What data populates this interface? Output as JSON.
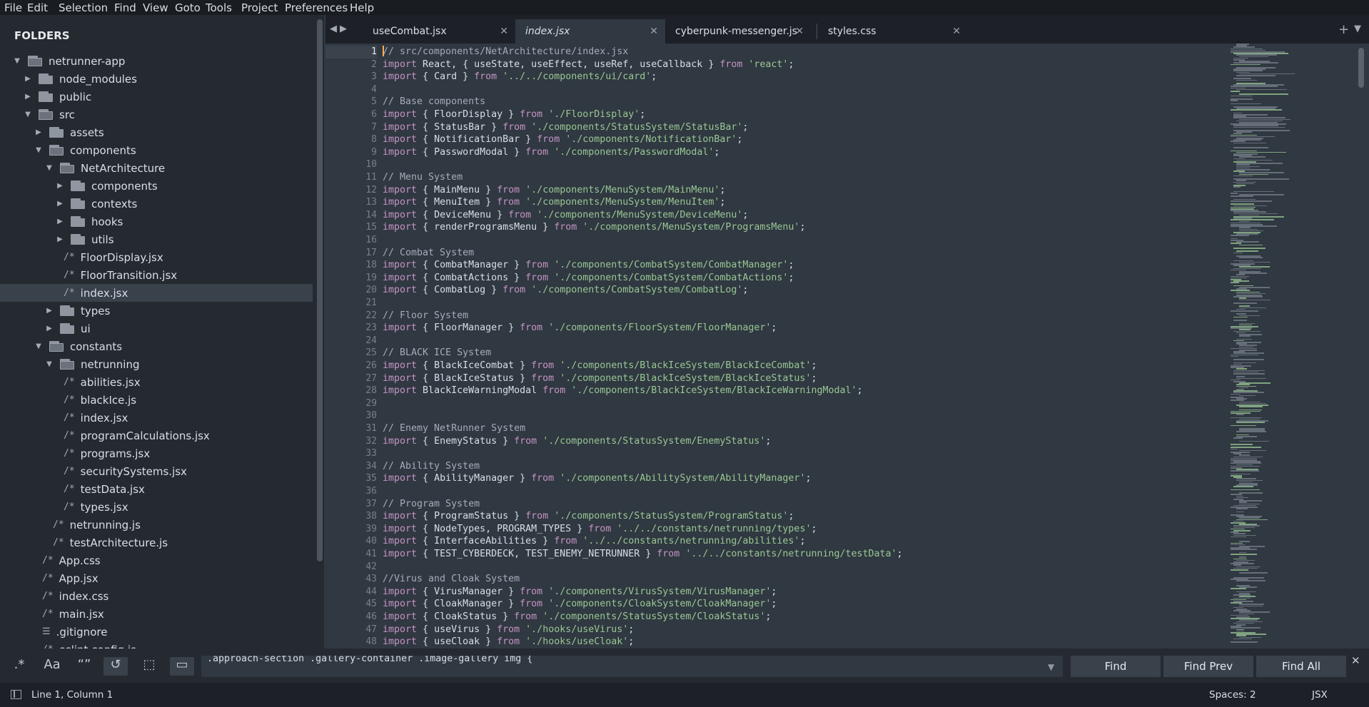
{
  "menu": [
    "File",
    "Edit",
    "Selection",
    "Find",
    "View",
    "Goto",
    "Tools",
    "Project",
    "Preferences",
    "Help"
  ],
  "sidebar": {
    "header": "FOLDERS",
    "items": [
      {
        "label": "netrunner-app",
        "type": "folder",
        "open": true,
        "depth": 0
      },
      {
        "label": "node_modules",
        "type": "folder",
        "open": false,
        "depth": 1
      },
      {
        "label": "public",
        "type": "folder",
        "open": false,
        "depth": 1
      },
      {
        "label": "src",
        "type": "folder",
        "open": true,
        "depth": 1
      },
      {
        "label": "assets",
        "type": "folder",
        "open": false,
        "depth": 2
      },
      {
        "label": "components",
        "type": "folder",
        "open": true,
        "depth": 2
      },
      {
        "label": "NetArchitecture",
        "type": "folder",
        "open": true,
        "depth": 3
      },
      {
        "label": "components",
        "type": "folder",
        "open": false,
        "depth": 4
      },
      {
        "label": "contexts",
        "type": "folder",
        "open": false,
        "depth": 4
      },
      {
        "label": "hooks",
        "type": "folder",
        "open": false,
        "depth": 4
      },
      {
        "label": "utils",
        "type": "folder",
        "open": false,
        "depth": 4
      },
      {
        "label": "FloorDisplay.jsx",
        "type": "file",
        "depth": 4
      },
      {
        "label": "FloorTransition.jsx",
        "type": "file",
        "depth": 4
      },
      {
        "label": "index.jsx",
        "type": "file",
        "depth": 4,
        "selected": true
      },
      {
        "label": "types",
        "type": "folder",
        "open": false,
        "depth": 3
      },
      {
        "label": "ui",
        "type": "folder",
        "open": false,
        "depth": 3
      },
      {
        "label": "constants",
        "type": "folder",
        "open": true,
        "depth": 2
      },
      {
        "label": "netrunning",
        "type": "folder",
        "open": true,
        "depth": 3
      },
      {
        "label": "abilities.jsx",
        "type": "file",
        "depth": 4
      },
      {
        "label": "blackIce.js",
        "type": "file",
        "depth": 4
      },
      {
        "label": "index.jsx",
        "type": "file",
        "depth": 4
      },
      {
        "label": "programCalculations.jsx",
        "type": "file",
        "depth": 4
      },
      {
        "label": "programs.jsx",
        "type": "file",
        "depth": 4
      },
      {
        "label": "securitySystems.jsx",
        "type": "file",
        "depth": 4
      },
      {
        "label": "testData.jsx",
        "type": "file",
        "depth": 4
      },
      {
        "label": "types.jsx",
        "type": "file",
        "depth": 4
      },
      {
        "label": "netrunning.js",
        "type": "file",
        "depth": 3
      },
      {
        "label": "testArchitecture.js",
        "type": "file",
        "depth": 3
      },
      {
        "label": "App.css",
        "type": "file",
        "depth": 2
      },
      {
        "label": "App.jsx",
        "type": "file",
        "depth": 2
      },
      {
        "label": "index.css",
        "type": "file",
        "depth": 2
      },
      {
        "label": "main.jsx",
        "type": "file",
        "depth": 2
      },
      {
        "label": ".gitignore",
        "type": "lines",
        "depth": 2
      },
      {
        "label": "eslint.config.js",
        "type": "file",
        "depth": 2
      }
    ]
  },
  "tabs": [
    {
      "label": "useCombat.jsx",
      "active": false
    },
    {
      "label": "index.jsx",
      "active": true
    },
    {
      "label": "cyberpunk-messenger.js",
      "active": false
    },
    {
      "label": "styles.css",
      "active": false
    }
  ],
  "editor": {
    "current_line": 1,
    "lines": [
      "// src/components/NetArchitecture/index.jsx",
      "import React, { useState, useEffect, useRef, useCallback } from 'react';",
      "import { Card } from '../../components/ui/card';",
      "",
      "// Base components",
      "import { FloorDisplay } from './FloorDisplay';",
      "import { StatusBar } from './components/StatusSystem/StatusBar';",
      "import { NotificationBar } from './components/NotificationBar';",
      "import { PasswordModal } from './components/PasswordModal';",
      "",
      "// Menu System",
      "import { MainMenu } from './components/MenuSystem/MainMenu';",
      "import { MenuItem } from './components/MenuSystem/MenuItem';",
      "import { DeviceMenu } from './components/MenuSystem/DeviceMenu';",
      "import { renderProgramsMenu } from './components/MenuSystem/ProgramsMenu';",
      "",
      "// Combat System",
      "import { CombatManager } from './components/CombatSystem/CombatManager';",
      "import { CombatActions } from './components/CombatSystem/CombatActions';",
      "import { CombatLog } from './components/CombatSystem/CombatLog';",
      "",
      "// Floor System",
      "import { FloorManager } from './components/FloorSystem/FloorManager';",
      "",
      "// BLACK ICE System",
      "import { BlackIceCombat } from './components/BlackIceSystem/BlackIceCombat';",
      "import { BlackIceStatus } from './components/BlackIceSystem/BlackIceStatus';",
      "import BlackIceWarningModal from './components/BlackIceSystem/BlackIceWarningModal';",
      "",
      "",
      "// Enemy NetRunner System",
      "import { EnemyStatus } from './components/StatusSystem/EnemyStatus';",
      "",
      "// Ability System",
      "import { AbilityManager } from './components/AbilitySystem/AbilityManager';",
      "",
      "// Program System",
      "import { ProgramStatus } from './components/StatusSystem/ProgramStatus';",
      "import { NodeTypes, PROGRAM_TYPES } from '../../constants/netrunning/types';",
      "import { InterfaceAbilities } from '../../constants/netrunning/abilities';",
      "import { TEST_CYBERDECK, TEST_ENEMY_NETRUNNER } from '../../constants/netrunning/testData';",
      "",
      "//Virus and Cloak System",
      "import { VirusManager } from './components/VirusSystem/VirusManager';",
      "import { CloakManager } from './components/CloakSystem/CloakManager';",
      "import { CloakStatus } from './components/StatusSystem/CloakStatus';",
      "import { useVirus } from './hooks/useVirus';",
      "import { useCloak } from './hooks/useCloak';"
    ]
  },
  "find": {
    "options": [
      {
        "icon": "regex-icon",
        "glyph": ".*"
      },
      {
        "icon": "case-sensitive-icon",
        "glyph": "Aa"
      },
      {
        "icon": "whole-word-icon",
        "glyph": "“”"
      },
      {
        "icon": "wrap-icon",
        "glyph": "↺"
      },
      {
        "icon": "in-selection-icon",
        "glyph": "⬚"
      },
      {
        "icon": "highlight-matches-icon",
        "glyph": "▭"
      }
    ],
    "query": ".approach-section .gallery-container .image-gallery img {",
    "find_label": "Find",
    "find_prev_label": "Find Prev",
    "find_all_label": "Find All"
  },
  "status": {
    "position": "Line 1, Column 1",
    "indent": "Spaces: 2",
    "syntax": "JSX"
  }
}
